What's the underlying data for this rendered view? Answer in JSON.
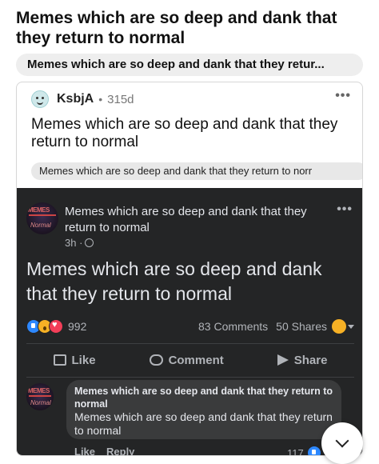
{
  "post": {
    "title": "Memes which are so deep and dank that they return to normal",
    "link_pill": "Memes which are so deep and dank that they retur..."
  },
  "reddit": {
    "username": "KsbjA",
    "separator": "•",
    "age": "315d",
    "menu": "•••",
    "title": "Memes which are so deep and dank that they return to normal",
    "link_pill": "Memes which are so deep and dank that they return to norr"
  },
  "facebook": {
    "page_name": "Memes which are so deep and dank that they return to normal",
    "logo_top": "MEMES",
    "logo_bottom": "Normal",
    "time": "3h ·",
    "menu": "•••",
    "body": "Memes which are so deep and dank that they return to normal",
    "reaction_count": "992",
    "comments": "83 Comments",
    "shares": "50 Shares",
    "actions": {
      "like": "Like",
      "comment": "Comment",
      "share": "Share"
    },
    "comment": {
      "name": "Memes which are so deep and dank that they return to normal",
      "text": "Memes which are so deep and dank that they return to normal",
      "like": "Like",
      "reply": "Reply",
      "react_count": "117"
    }
  },
  "colors": {
    "dark_bg": "#242526",
    "bubble_bg": "#3a3b3c",
    "fb_text": "#e4e6eb",
    "fb_muted": "#b0b3b8",
    "like_blue": "#2d88ff"
  }
}
